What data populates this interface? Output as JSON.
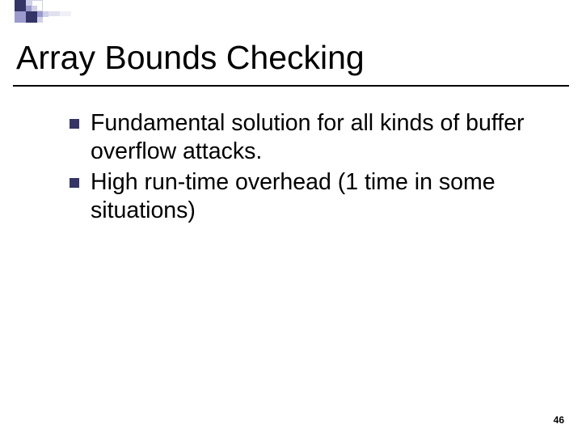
{
  "title": "Array Bounds Checking",
  "bullets": [
    "Fundamental solution for all kinds of buffer overflow attacks.",
    "High run-time overhead (1 time in some situations)"
  ],
  "page_number": "46",
  "theme": {
    "bullet_color": "#343467",
    "deco_dark": "#343467",
    "deco_mid": "#9a9acf",
    "deco_light": "#d2d2e8"
  }
}
